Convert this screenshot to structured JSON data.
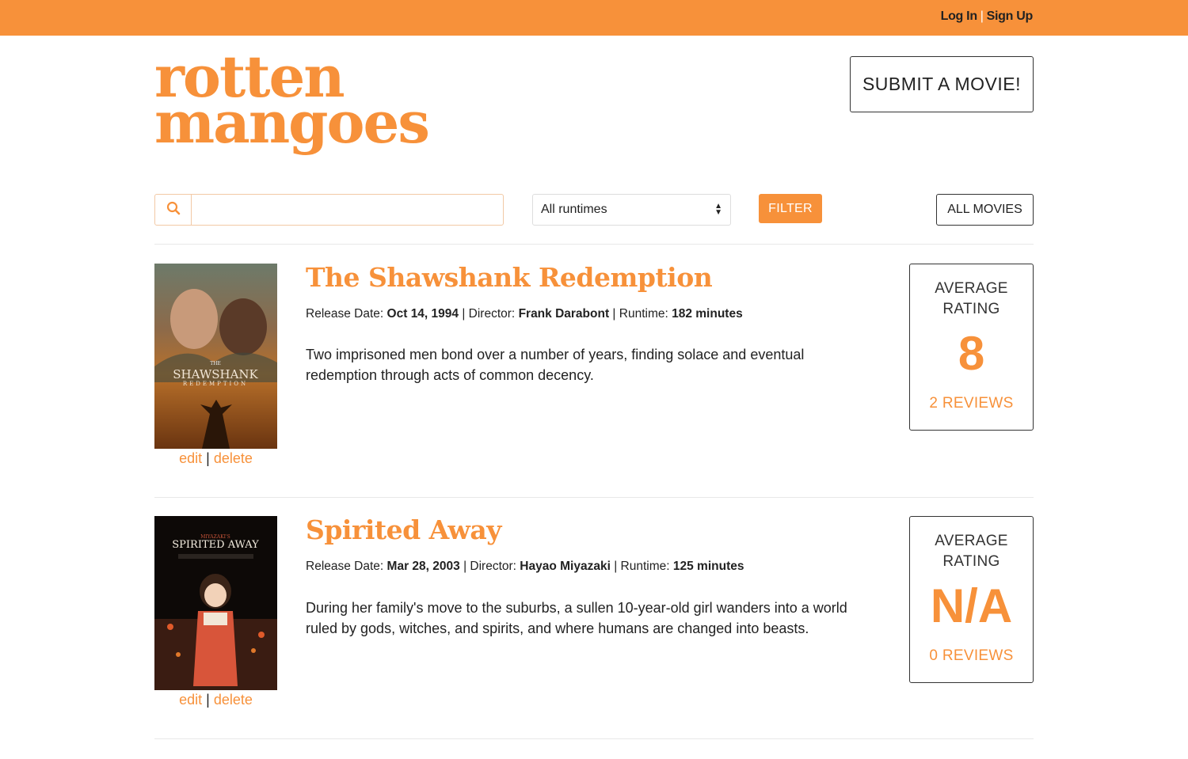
{
  "header": {
    "login_label": "Log In",
    "separator": "|",
    "signup_label": "Sign Up",
    "brand_color": "#f7913a"
  },
  "logo": {
    "line1": "rotten",
    "line2": "mangoes"
  },
  "submit_button": "SUBMIT A MOVIE!",
  "search": {
    "icon": "search-icon",
    "value": "",
    "placeholder": ""
  },
  "runtime_filter": {
    "selected": "All runtimes"
  },
  "filter_button": "FILTER",
  "all_movies_button": "ALL MOVIES",
  "movies": [
    {
      "title": "The Shawshank Redemption",
      "release_label": "Release Date:",
      "release_date": "Oct 14, 1994",
      "director_label": "Director:",
      "director": "Frank Darabont",
      "runtime_label": "Runtime:",
      "runtime": "182 minutes",
      "description": "Two imprisoned men bond over a number of years, finding solace and eventual redemption through acts of common decency.",
      "poster_text": "SHAWSHANK",
      "poster_subtext": "REDEMPTION",
      "poster_small": "THE",
      "edit_label": "edit",
      "delete_label": "delete",
      "rating_label_1": "AVERAGE",
      "rating_label_2": "RATING",
      "rating_value": "8",
      "reviews": "2 REVIEWS"
    },
    {
      "title": "Spirited Away",
      "release_label": "Release Date:",
      "release_date": "Mar 28, 2003",
      "director_label": "Director:",
      "director": "Hayao Miyazaki",
      "runtime_label": "Runtime:",
      "runtime": "125 minutes",
      "description": "During her family's move to the suburbs, a sullen 10-year-old girl wanders into a world ruled by gods, witches, and spirits, and where humans are changed into beasts.",
      "poster_text": "SPIRITED AWAY",
      "poster_subtext": "MIYAZAKI'S",
      "edit_label": "edit",
      "delete_label": "delete",
      "rating_label_1": "AVERAGE",
      "rating_label_2": "RATING",
      "rating_value": "N/A",
      "reviews": "0 REVIEWS"
    }
  ]
}
